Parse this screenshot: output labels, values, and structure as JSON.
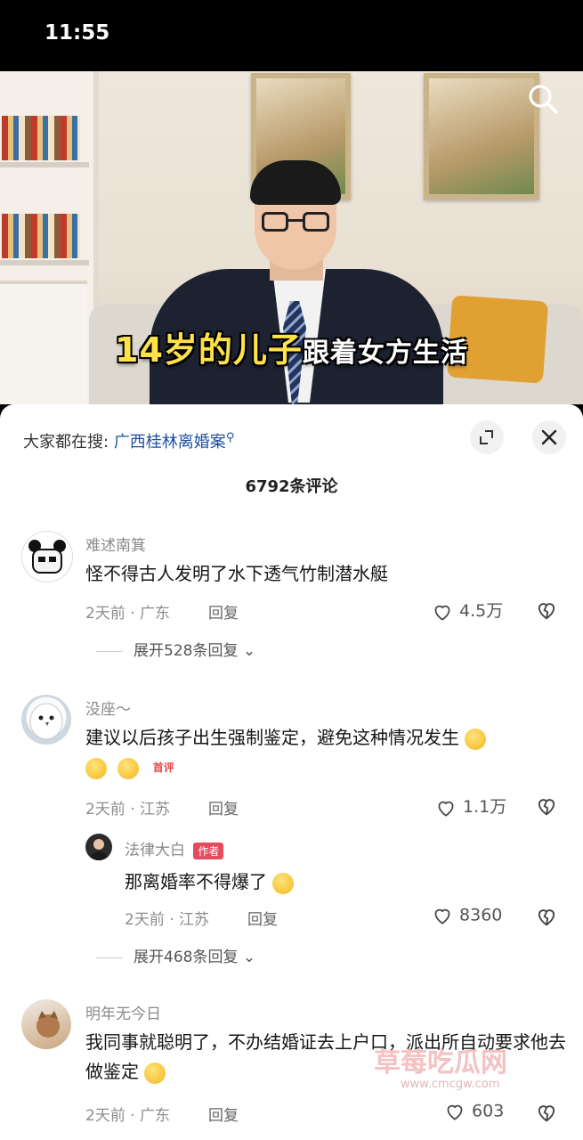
{
  "status_bar": {
    "time": "11:55"
  },
  "video": {
    "subtitle_highlight": "14岁的儿子",
    "subtitle_rest": "跟着女方生活"
  },
  "sheet": {
    "search_prefix": "大家都在搜:",
    "search_keyword": "广西桂林离婚案",
    "comment_count": "6792条评论"
  },
  "comments": [
    {
      "user": "难述南箕",
      "text": "怪不得古人发明了水下透气竹制潜水艇",
      "meta": "2天前 · 广东",
      "reply_label": "回复",
      "likes": "4.5万",
      "expand": "展开528条回复"
    },
    {
      "user": "没座～",
      "text": "建议以后孩子出生强制鉴定，避免这种情况发生",
      "badge": "首评",
      "meta": "2天前 · 江苏",
      "reply_label": "回复",
      "likes": "1.1万",
      "sub_reply": {
        "user": "法律大白",
        "badge": "作者",
        "text": "那离婚率不得爆了",
        "meta": "2天前 · 江苏",
        "reply_label": "回复",
        "likes": "8360"
      },
      "expand": "展开468条回复"
    },
    {
      "user": "明年无今日",
      "text": "我同事就聪明了，不办结婚证去上户口，派出所自动要求他去做鉴定",
      "meta": "2天前 · 广东",
      "reply_label": "回复",
      "likes": "603"
    }
  ],
  "watermark": {
    "main": "草莓吃瓜网",
    "sub": "www.cmcgw.com"
  },
  "icons": {
    "search": "search-icon",
    "expand": "expand-icon",
    "close": "close-icon",
    "like": "heart-icon",
    "dislike": "broken-heart-icon"
  }
}
